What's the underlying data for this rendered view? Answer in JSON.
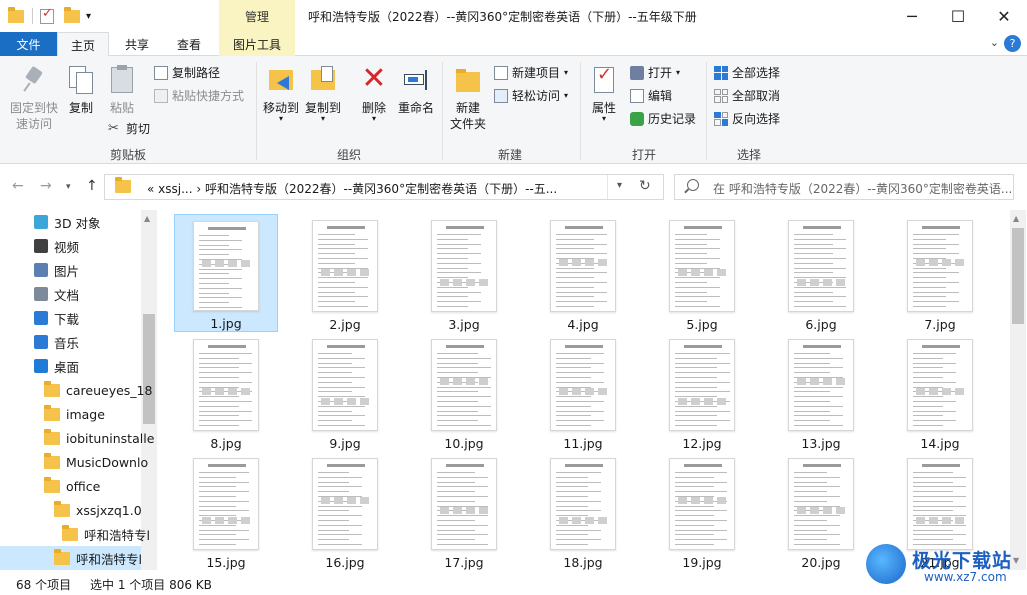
{
  "window": {
    "title": "呼和浩特专版（2022春）--黄冈360°定制密卷英语（下册）--五年级下册",
    "context_tab": "管理",
    "controls": [
      "─",
      "☐",
      "✕"
    ]
  },
  "tabs": {
    "file": "文件",
    "home": "主页",
    "share": "共享",
    "view": "查看",
    "picture_tools": "图片工具"
  },
  "ribbon": {
    "clipboard": {
      "label": "剪贴板",
      "pin": "固定到快\n速访问",
      "copy": "复制",
      "paste": "粘贴",
      "copy_path": "复制路径",
      "paste_shortcut": "粘贴快捷方式",
      "cut": "剪切"
    },
    "organize": {
      "label": "组织",
      "move_to": "移动到",
      "copy_to": "复制到",
      "delete": "删除",
      "rename": "重命名"
    },
    "new": {
      "label": "新建",
      "new_folder": "新建\n文件夹",
      "new_item": "新建项目",
      "easy_access": "轻松访问"
    },
    "open": {
      "label": "打开",
      "properties": "属性",
      "open": "打开",
      "edit": "编辑",
      "history": "历史记录"
    },
    "select": {
      "label": "选择",
      "select_all": "全部选择",
      "select_none": "全部取消",
      "invert": "反向选择"
    }
  },
  "address": {
    "path": "«  xssj...  ›  呼和浩特专版（2022春）--黄冈360°定制密卷英语（下册）--五...",
    "search_placeholder": "在 呼和浩特专版（2022春）--黄冈360°定制密卷英语..."
  },
  "nav_tree": [
    {
      "label": "3D 对象",
      "icon": "3d-objects-icon"
    },
    {
      "label": "视频",
      "icon": "video-icon"
    },
    {
      "label": "图片",
      "icon": "pictures-icon"
    },
    {
      "label": "文档",
      "icon": "documents-icon"
    },
    {
      "label": "下载",
      "icon": "download-icon"
    },
    {
      "label": "音乐",
      "icon": "music-icon"
    },
    {
      "label": "桌面",
      "icon": "desktop-icon"
    },
    {
      "label": "careueyes_18",
      "icon": "folder-icon"
    },
    {
      "label": "image",
      "icon": "folder-icon"
    },
    {
      "label": "iobituninstalle",
      "icon": "folder-icon"
    },
    {
      "label": "MusicDownlo",
      "icon": "folder-icon"
    },
    {
      "label": "office",
      "icon": "folder-icon"
    },
    {
      "label": "xssjxzq1.0",
      "icon": "folder-icon"
    },
    {
      "label": "呼和浩特专l",
      "icon": "folder-icon"
    },
    {
      "label": "呼和浩特专l",
      "icon": "folder-icon"
    }
  ],
  "files": [
    "1.jpg",
    "2.jpg",
    "3.jpg",
    "4.jpg",
    "5.jpg",
    "6.jpg",
    "7.jpg",
    "8.jpg",
    "9.jpg",
    "10.jpg",
    "11.jpg",
    "12.jpg",
    "13.jpg",
    "14.jpg",
    "15.jpg",
    "16.jpg",
    "17.jpg",
    "18.jpg",
    "19.jpg",
    "20.jpg",
    "21.jpg"
  ],
  "selected_file": "1.jpg",
  "status": {
    "count": "68 个项目",
    "selection": "选中 1 个项目  806 KB"
  },
  "watermark": {
    "title": "极光下载站",
    "url": "www.xz7.com"
  },
  "colors": {
    "accent": "#1a6fc4",
    "selection": "#cce8ff",
    "context_tab": "#faf3c2",
    "folder": "#f5c24a"
  }
}
